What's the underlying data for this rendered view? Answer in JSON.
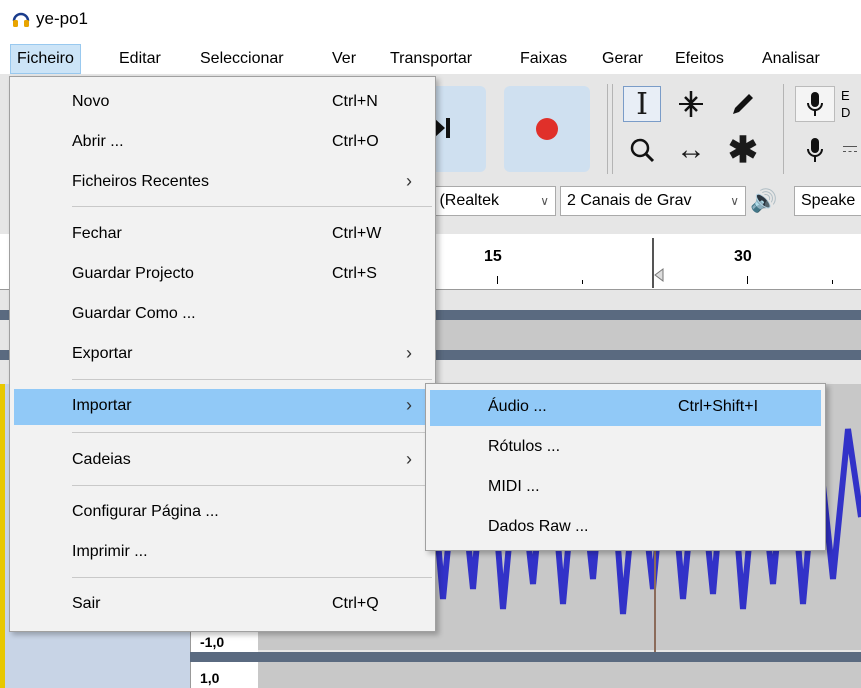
{
  "window": {
    "title": "ye-po1",
    "app_icon": "headphones-icon",
    "accent": "#e8a400"
  },
  "menubar": {
    "items": [
      "Ficheiro",
      "Editar",
      "Seleccionar",
      "Ver",
      "Transportar",
      "Faixas",
      "Gerar",
      "Efeitos",
      "Analisar"
    ],
    "active": "Ficheiro"
  },
  "background": {
    "toolbar_icons": [
      "skip-to-end-icon",
      "record-icon",
      "selection-tool-icon",
      "envelope-tool-icon",
      "draw-tool-icon",
      "zoom-tool-icon",
      "time-shift-tool-icon",
      "multi-tool-icon",
      "microphone-icon",
      "speaker-level-icon"
    ],
    "meter_letters": {
      "e": "E",
      "d": "D"
    },
    "device": {
      "input_partial": "y (Realtek",
      "channels": "2 Canais de Grav",
      "output_partial": "Speake"
    },
    "ruler": {
      "labels": [
        "15",
        "30"
      ]
    },
    "scale": {
      "neg_one": "-1,0",
      "one": "1,0"
    },
    "colors": {
      "waveform": "#3232c8",
      "record": "#e0302a",
      "track_bg": "#c8c8c8",
      "panel": "#c8d4e6"
    }
  },
  "file_menu": {
    "items": [
      {
        "label": "Novo",
        "shortcut": "Ctrl+N"
      },
      {
        "label": "Abrir ...",
        "shortcut": "Ctrl+O"
      },
      {
        "label": "Ficheiros Recentes",
        "submenu": true
      },
      {
        "label": "Fechar",
        "shortcut": "Ctrl+W"
      },
      {
        "label": "Guardar Projecto",
        "shortcut": "Ctrl+S"
      },
      {
        "label": "Guardar Como ..."
      },
      {
        "label": "Exportar",
        "submenu": true
      },
      {
        "label": "Importar",
        "submenu": true,
        "highlighted": true
      },
      {
        "label": "Cadeias",
        "submenu": true
      },
      {
        "label": "Configurar Página ..."
      },
      {
        "label": "Imprimir ..."
      },
      {
        "label": "Sair",
        "shortcut": "Ctrl+Q"
      }
    ],
    "arrow_glyph": "›"
  },
  "import_submenu": {
    "items": [
      {
        "label": "Áudio ...",
        "shortcut": "Ctrl+Shift+I",
        "highlighted": true
      },
      {
        "label": "Rótulos ..."
      },
      {
        "label": "MIDI ..."
      },
      {
        "label": "Dados Raw ..."
      }
    ]
  }
}
